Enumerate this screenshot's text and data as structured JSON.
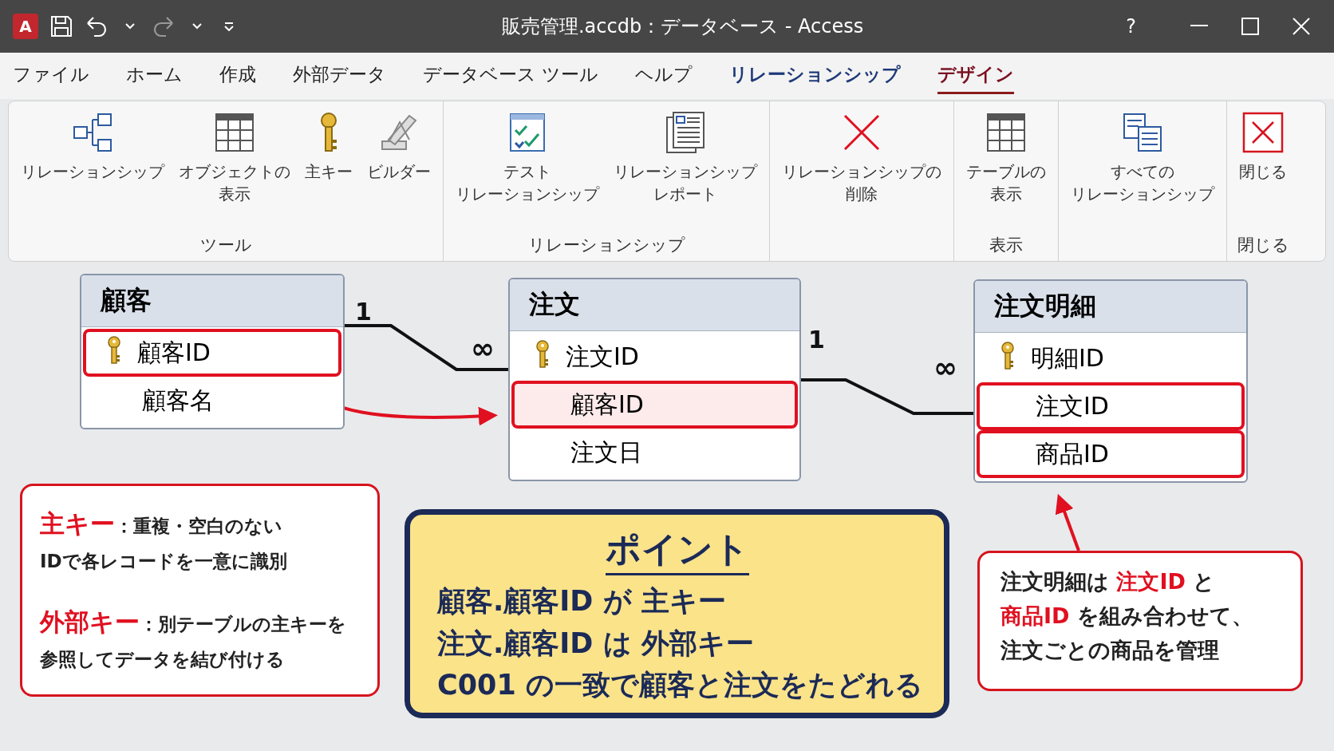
{
  "window": {
    "title": "販売管理.accdb：データベース - Access",
    "app_letter": "A",
    "help": "?"
  },
  "menu_tabs": [
    {
      "label": "ファイル",
      "selected": false,
      "contextual": false
    },
    {
      "label": "ホーム",
      "selected": false,
      "contextual": false
    },
    {
      "label": "作成",
      "selected": false,
      "contextual": false
    },
    {
      "label": "外部データ",
      "selected": false,
      "contextual": false
    },
    {
      "label": "データベース ツール",
      "selected": false,
      "contextual": false
    },
    {
      "label": "ヘルプ",
      "selected": false,
      "contextual": false
    },
    {
      "label": "リレーションシップ",
      "selected": false,
      "contextual": true
    },
    {
      "label": "デザイン",
      "selected": true,
      "contextual": true
    }
  ],
  "ribbon_groups": [
    {
      "label": "ツール",
      "buttons": [
        {
          "lines": [
            "リレーションシップ"
          ],
          "kind": "relationships"
        },
        {
          "lines": [
            "オブジェクトの",
            "表示"
          ],
          "kind": "grid"
        },
        {
          "lines": [
            "主キー"
          ],
          "kind": "key"
        },
        {
          "lines": [
            "ビルダー"
          ],
          "kind": "builder"
        }
      ]
    },
    {
      "label": "リレーションシップ",
      "buttons": [
        {
          "lines": [
            "テスト",
            "リレーションシップ"
          ],
          "kind": "test"
        },
        {
          "lines": [
            "リレーションシップ",
            "レポート"
          ],
          "kind": "report"
        }
      ]
    },
    {
      "buttons": [
        {
          "lines": [
            "リレーションシップの",
            "削除"
          ],
          "kind": "delete"
        }
      ]
    },
    {
      "label": "表示",
      "buttons": [
        {
          "lines": [
            "テーブルの",
            "表示"
          ],
          "kind": "grid"
        }
      ]
    },
    {
      "buttons": [
        {
          "lines": [
            "すべての",
            "リレーションシップ"
          ],
          "kind": "all"
        }
      ]
    },
    {
      "label": "閉じる",
      "buttons": [
        {
          "lines": [
            "閉じる"
          ],
          "kind": "close"
        }
      ]
    }
  ],
  "tables": [
    {
      "title": "顧客",
      "fields": [
        {
          "name": "顧客ID",
          "primary_key": true,
          "outlined": true,
          "tinted": false
        },
        {
          "name": "顧客名",
          "primary_key": false,
          "outlined": false,
          "tinted": false
        }
      ]
    },
    {
      "title": "注文",
      "fields": [
        {
          "name": "注文ID",
          "primary_key": true,
          "outlined": false,
          "tinted": false
        },
        {
          "name": "顧客ID",
          "primary_key": false,
          "outlined": true,
          "tinted": true
        },
        {
          "name": "注文日",
          "primary_key": false,
          "outlined": false,
          "tinted": false
        }
      ]
    },
    {
      "title": "注文明細",
      "fields": [
        {
          "name": "明細ID",
          "primary_key": true,
          "outlined": false,
          "tinted": false
        },
        {
          "name": "注文ID",
          "primary_key": false,
          "outlined": true,
          "tinted": false
        },
        {
          "name": "商品ID",
          "primary_key": false,
          "outlined": true,
          "tinted": false
        }
      ]
    }
  ],
  "relationships": [
    {
      "one": "1",
      "many": "∞"
    },
    {
      "one": "1",
      "many": "∞"
    }
  ],
  "key_note": [
    [
      "**主キー**：重複・空白のない",
      "IDで各レコードを一意に識別"
    ],
    [
      "**外部キー**：別テーブルの主キーを",
      "参照してデータを結び付ける"
    ]
  ],
  "point": {
    "title": "ポイント",
    "lines": [
      "顧客.顧客ID が 主キー",
      "注文.顧客ID は 外部キー",
      "C001 の一致で顧客と注文をたどれる"
    ]
  },
  "detail_note": [
    "注文明細は **注文ID** と",
    "**商品ID** を組み合わせて、",
    "注文ごとの商品を管理"
  ]
}
